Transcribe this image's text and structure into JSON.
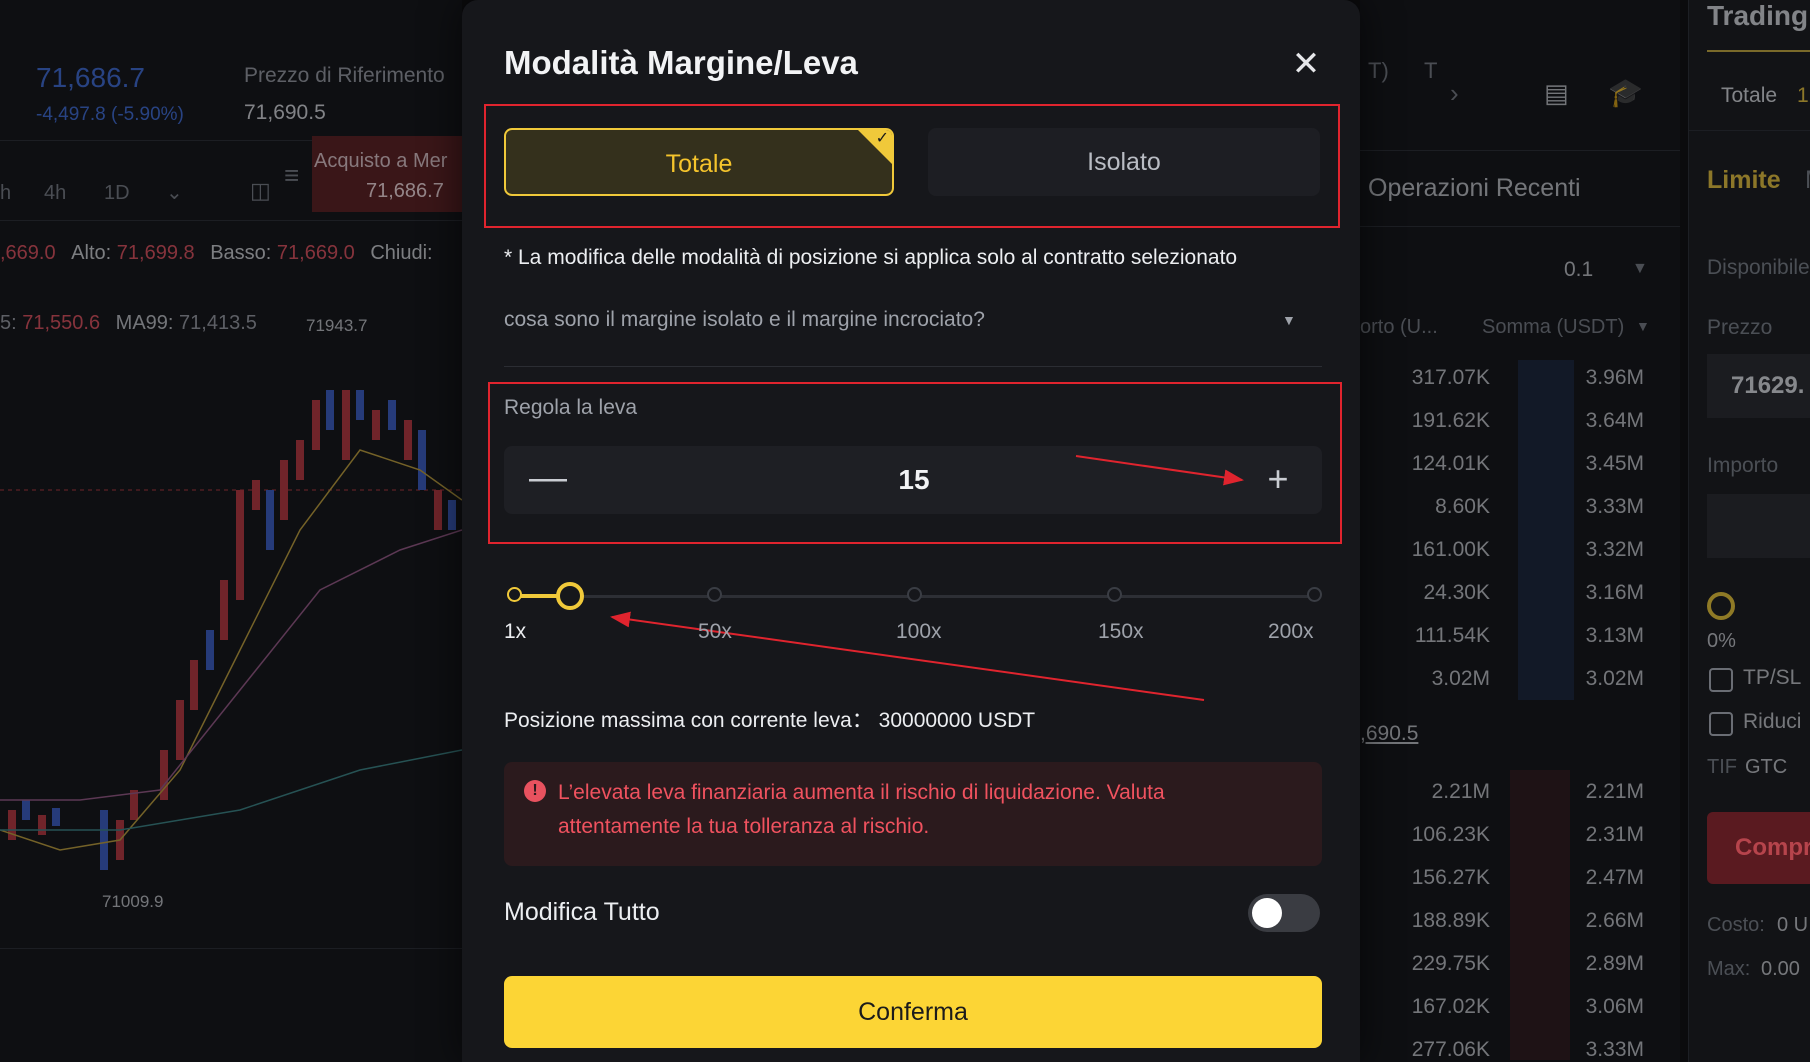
{
  "background": {
    "header": {
      "price": "71,686.7",
      "change": "-4,497.8 (-5.90%)",
      "ref_label": "Prezzo di Riferimento",
      "ref_value": "71,690.5",
      "tab_partial": "T)",
      "tab_partial2": "T"
    },
    "toolbar": {
      "intervals": [
        "h",
        "4h",
        "1D"
      ],
      "market_buy_label": "Acquisto a Mer",
      "market_buy_value": "71,686.7"
    },
    "ohlc": {
      "prefix": ",669.0",
      "high_label": "Alto:",
      "high": "71,699.8",
      "low_label": "Basso:",
      "low": "71,669.0",
      "close_label": "Chiudi:"
    },
    "ma": {
      "prefix_label": "5:",
      "prefix_value": "71,550.6",
      "ma99_label": "MA99:",
      "ma99_value": "71,413.5"
    },
    "chart_marks": {
      "high_mark": "71943.7",
      "low_mark": "71009.9"
    },
    "orderbook": {
      "title": "Operazioni Recenti",
      "precision": "0.1",
      "col1": "orto (U...",
      "col2": "Somma (USDT)",
      "mid_price": ",690.5",
      "rows_top": [
        [
          "317.07K",
          "3.96M"
        ],
        [
          "191.62K",
          "3.64M"
        ],
        [
          "124.01K",
          "3.45M"
        ],
        [
          "8.60K",
          "3.33M"
        ],
        [
          "161.00K",
          "3.32M"
        ],
        [
          "24.30K",
          "3.16M"
        ],
        [
          "111.54K",
          "3.13M"
        ],
        [
          "3.02M",
          "3.02M"
        ]
      ],
      "rows_bottom": [
        [
          "2.21M",
          "2.21M"
        ],
        [
          "106.23K",
          "2.31M"
        ],
        [
          "156.27K",
          "2.47M"
        ],
        [
          "188.89K",
          "2.66M"
        ],
        [
          "229.75K",
          "2.89M"
        ],
        [
          "167.02K",
          "3.06M"
        ],
        [
          "277.06K",
          "3.33M"
        ]
      ]
    },
    "trade_panel": {
      "title": "Trading",
      "mode": "Totale",
      "mode_suffix": "1",
      "order_type": "Limite",
      "order_type_next": "M",
      "available_label": "Disponibile",
      "price_label": "Prezzo",
      "price_value": "71629.",
      "amount_label": "Importo",
      "pct": "0%",
      "tpsl": "TP/SL",
      "reduce": "Riduci",
      "tif_label": "TIF",
      "tif_value": "GTC",
      "buy_button": "Compr",
      "cost_label": "Costo:",
      "cost_value": "0 U",
      "max_label": "Max:",
      "max_value": "0.00"
    }
  },
  "modal": {
    "title": "Modalità Margine/Leva",
    "close_icon": "close-icon",
    "modes": {
      "totale": "Totale",
      "isolato": "Isolato",
      "selected": "totale"
    },
    "note": "* La modifica delle modalità di posizione si applica solo al contratto selezionato",
    "faq": "cosa sono il margine isolato e il margine incrociato?",
    "leverage": {
      "label": "Regola la leva",
      "value": "15",
      "min_label": "1x",
      "ticks": [
        "1x",
        "50x",
        "100x",
        "150x",
        "200x"
      ],
      "slider_fraction": 0.07
    },
    "max_position": "Posizione massima con corrente leva： 30000000  USDT",
    "warning": "L’elevata leva finanziaria aumenta il rischio di liquidazione. Valuta attentamente la tua tolleranza al rischio.",
    "modify_all_label": "Modifica Tutto",
    "modify_all_on": false,
    "confirm": "Conferma"
  },
  "colors": {
    "accent": "#fcd535",
    "highlight": "#e0242e",
    "down": "#e8525f",
    "up": "#3f6fe0"
  }
}
